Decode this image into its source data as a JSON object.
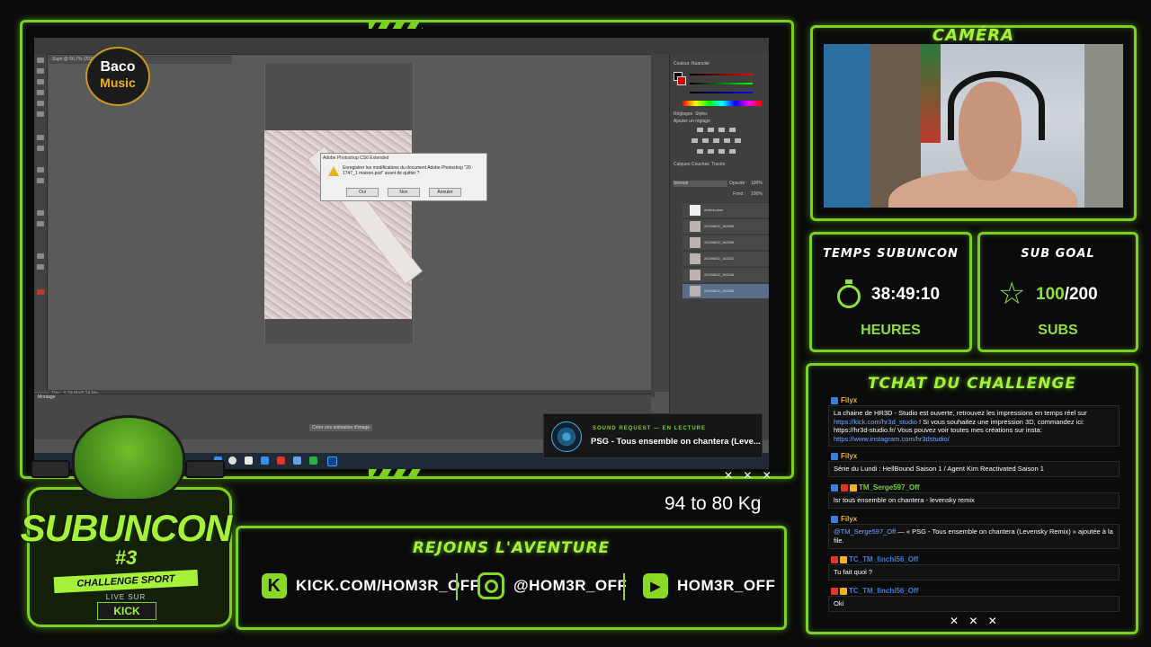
{
  "photoshop": {
    "doc_tab": "Sujet @ 66,7% (20240602_182055, RVB/8) *",
    "dialog": {
      "title": "Adobe Photoshop CS6 Extended",
      "message": "Enregistrer les modifications du document Adobe Photoshop \"20 1747_1 maison.psd\" avant de quitter ?",
      "buttons": [
        "Oui",
        "Non",
        "Annuler"
      ]
    },
    "panels": {
      "color_tab": "Couleur",
      "swatches_tab": "Nuancier",
      "adjust_tab": "Réglages",
      "styles_tab": "Styles",
      "adjust_hint": "Ajouter un réglage",
      "layers_tabs": [
        "Calques",
        "Couches",
        "Tracés"
      ],
      "blend_mode": "Normal",
      "opacity_label": "Opacité :",
      "opacity_value": "100%",
      "fill_label": "Fond :",
      "fill_value": "100%"
    },
    "layers": [
      "Arrière-plan",
      "20240602_182055",
      "20240602_182056",
      "20240602_182102",
      "20240602_182108",
      "20240602_182055"
    ],
    "status": "Doc : 5,24 Mo/5,24 Mo",
    "montage_label": "Montage",
    "montage_button": "Créer une animation d'image"
  },
  "baco": {
    "line1": "Baco",
    "line2": "Music"
  },
  "sound_request": {
    "label": "SOUND REQUEST — EN LECTURE",
    "song": "PSG - Tous ensemble on chantera (Leve..."
  },
  "weight_text": "94 to 80 Kg",
  "social": {
    "title": "REJOINS L'AVENTURE",
    "kick": "KICK.COM/HOM3R_OFF",
    "instagram": "@HOM3R_OFF",
    "youtube": "HOM3R_OFF"
  },
  "camera_title": "CAMÉRA",
  "timer": {
    "title": "TEMPS SUBUNCON",
    "value": "38:49:10",
    "unit": "HEURES"
  },
  "goal": {
    "title": "SUB GOAL",
    "current": "100",
    "total": "/200",
    "unit": "SUBS"
  },
  "chat": {
    "title": "TCHAT DU CHALLENGE",
    "messages": [
      {
        "user": "Filyx",
        "user_color": "#f1b21d",
        "text": "La chaine de HR3D - Studio est ouverte, retrouvez les impressions en temps réel sur ",
        "link1": "https://kick.com/hr3d_studio",
        "text2": " ! Si vous souhaitez une impression 3D, commandez ici: https://hr3d-studio.fr/ Vous pouvez voir toutes mes créations sur insta: ",
        "link2": "https://www.instagram.com/hr3dstudio/"
      },
      {
        "user": "Filyx",
        "user_color": "#f1b21d",
        "text": "Série du Lundi : HellBound Saison 1 / Agent Kim Reactivated Saison 1"
      },
      {
        "user": "TM_Serge597_Off",
        "user_color": "#7bd11f",
        "text": "lsr tous ensemble on chantera - levensky remix"
      },
      {
        "user": "Filyx",
        "user_color": "#f1b21d",
        "mention": "@TM_Serge597_Off",
        "text": " — « PSG - Tous ensemble on chantera (Levensky Remix) » ajoutée à la file."
      },
      {
        "user": "TC_TM_finchi56_Off",
        "user_color": "#3a7ed8",
        "text": "Tu fait quoi ?"
      },
      {
        "user": "TC_TM_finchi56_Off",
        "user_color": "#3a7ed8",
        "text": "Oki"
      }
    ]
  },
  "subuncon": {
    "word": "SUBUNCON",
    "number": "#3",
    "challenge": "CHALLENGE SPORT",
    "live": "LIVE SUR",
    "platform": "KICK"
  },
  "xmarks": "✕ ✕ ✕",
  "colors": {
    "accent": "#7bd11f",
    "accent_light": "#a6f23a",
    "gold": "#f1b21d"
  }
}
